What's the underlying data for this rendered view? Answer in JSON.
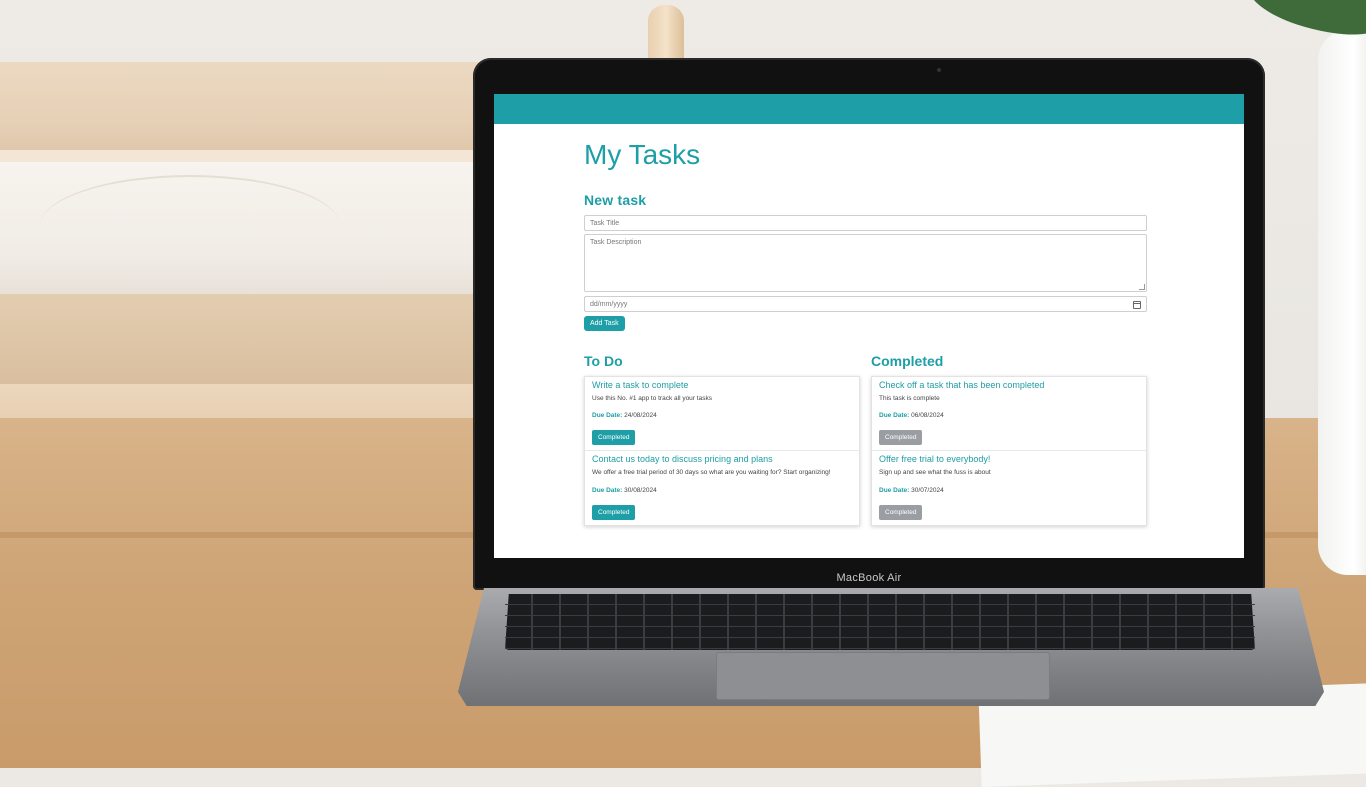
{
  "laptop": {
    "brand": "MacBook Air"
  },
  "app": {
    "title": "My Tasks",
    "accent_color": "#1e9ea6",
    "new_task": {
      "heading": "New task",
      "title_placeholder": "Task Title",
      "description_placeholder": "Task Description",
      "date_placeholder": "dd/mm/yyyy",
      "add_button": "Add Task"
    },
    "todo": {
      "heading": "To Do",
      "due_label": "Due Date:",
      "tasks": [
        {
          "title": "Write a task to complete",
          "description": "Use this No. #1 app to track all your tasks",
          "due_date": "24/08/2024",
          "button": "Completed"
        },
        {
          "title": "Contact us today to discuss pricing and plans",
          "description": "We offer a free trial period of 30 days so what are you waiting for? Start organizing!",
          "due_date": "30/08/2024",
          "button": "Completed"
        }
      ]
    },
    "completed": {
      "heading": "Completed",
      "due_label": "Due Date:",
      "tasks": [
        {
          "title": "Check off a task that has been completed",
          "description": "This task is complete",
          "due_date": "06/08/2024",
          "button": "Completed"
        },
        {
          "title": "Offer free trial to everybody!",
          "description": "Sign up and see what the fuss is about",
          "due_date": "30/07/2024",
          "button": "Completed"
        }
      ]
    }
  }
}
